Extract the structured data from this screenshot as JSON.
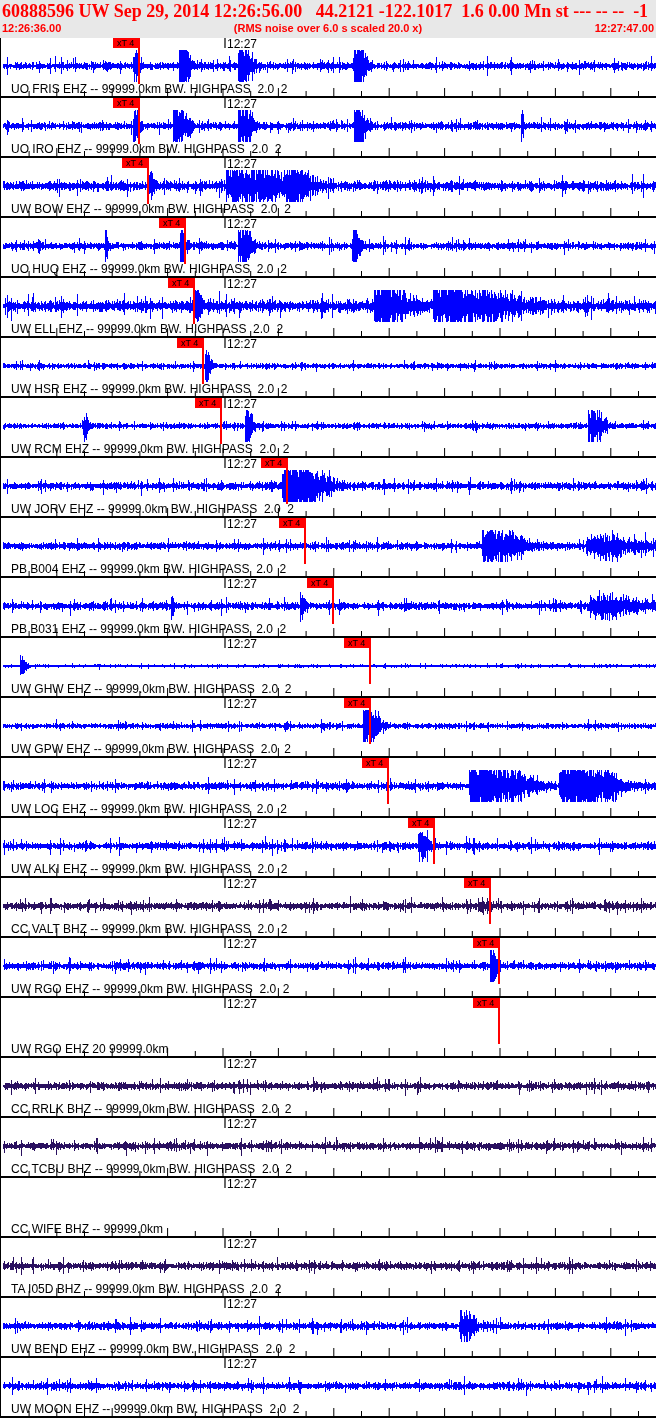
{
  "header": {
    "title": "60888596 UW Sep 29, 2014 12:26:56.00   44.2121 -122.1017  1.6 0.00 Mn st --- -- --  -1",
    "start_time": "12:26:36.00",
    "note": "(RMS noise over 6.0 s scaled 20.0 x)",
    "end_time": "12:27:47.00"
  },
  "traces": [
    {
      "kind": "waveform",
      "label": "UO FRIS EHZ -- 99999.0km BW. HIGHPASS  2.0  2",
      "time_label": "12:27",
      "color": "#0000ff",
      "pick": "xT 4"
    },
    {
      "kind": "waveform",
      "label": "UO IRO EHZ -- 99999.0km BW. HIGHPASS  2.0  2",
      "time_label": "12:27",
      "color": "#0000ff",
      "pick": "xT 4"
    },
    {
      "kind": "waveform",
      "label": "UW BOW EHZ -- 99999.0km BW. HIGHPASS  2.0  2",
      "time_label": "12:27",
      "color": "#0000ff",
      "pick": "xT 4"
    },
    {
      "kind": "waveform",
      "label": "UO HUQ EHZ -- 99999.0km BW. HIGHPASS  2.0  2",
      "time_label": "12:27",
      "color": "#0000ff",
      "pick": "xT 4"
    },
    {
      "kind": "waveform",
      "label": "UW ELL EHZ -- 99999.0km BW. HIGHPASS  2.0  2",
      "time_label": "12:27",
      "color": "#0000ff",
      "pick": "xT 4"
    },
    {
      "kind": "waveform",
      "label": "UW HSR EHZ -- 99999.0km BW. HIGHPASS  2.0  2",
      "time_label": "12:27",
      "color": "#0000ff",
      "pick": "xT 4"
    },
    {
      "kind": "waveform",
      "label": "UW RCM EHZ -- 99999.0km BW. HIGHPASS  2.0  2",
      "time_label": "12:27",
      "color": "#0000ff",
      "pick": "xT 4"
    },
    {
      "kind": "waveform",
      "label": "UW JORV EHZ -- 99999.0km BW. HIGHPASS  2.0  2",
      "time_label": "12:27",
      "color": "#0000ff",
      "pick": "xT 4"
    },
    {
      "kind": "waveform",
      "label": "PB B004 EHZ -- 99999.0km BW. HIGHPASS  2.0  2",
      "time_label": "12:27",
      "color": "#0000ff",
      "pick": "xT 4"
    },
    {
      "kind": "waveform",
      "label": "PB B031 EHZ -- 99999.0km BW. HIGHPASS  2.0  2",
      "time_label": "12:27",
      "color": "#0000ff",
      "pick": "xT 4"
    },
    {
      "kind": "waveform",
      "label": "UW GHW EHZ -- 99999.0km BW. HIGHPASS  2.0  2",
      "time_label": "12:27",
      "color": "#0000ff",
      "pick": "xT 4"
    },
    {
      "kind": "waveform",
      "label": "UW GPW EHZ -- 99999.0km BW. HIGHPASS  2.0  2",
      "time_label": "12:27",
      "color": "#0000ff",
      "pick": "xT 4"
    },
    {
      "kind": "waveform",
      "label": "UW LOC EHZ -- 99999.0km BW. HIGHPASS  2.0  2",
      "time_label": "12:27",
      "color": "#0000ff",
      "pick": "xT 4"
    },
    {
      "kind": "waveform",
      "label": "UW ALKI EHZ -- 99999.0km BW. HIGHPASS  2.0  2",
      "time_label": "12:27",
      "color": "#0000ff",
      "pick": "xT 4"
    },
    {
      "kind": "waveform",
      "label": "CC VALT BHZ -- 99999.0km BW. HIGHPASS  2.0  2",
      "time_label": "12:27",
      "color": "#2a1060",
      "pick": "xT 4"
    },
    {
      "kind": "waveform",
      "label": "UW RGO EHZ -- 99999.0km BW. HIGHPASS  2.0  2",
      "time_label": "12:27",
      "color": "#0000ff",
      "pick": "xT 4"
    },
    {
      "kind": "empty",
      "label": "UW RGO EHZ 20 99999.0km",
      "time_label": "12:27",
      "pick": "xT 4"
    },
    {
      "kind": "waveform",
      "label": "CC RRLK BHZ -- 99999.0km BW. HIGHPASS  2.0  2",
      "time_label": "12:27",
      "color": "#2a1060"
    },
    {
      "kind": "waveform",
      "label": "CC TCBU BHZ -- 99999.0km BW. HIGHPASS  2.0  2",
      "time_label": "12:27",
      "color": "#2a1060"
    },
    {
      "kind": "empty",
      "label": "CC WIFE BHZ -- 99999.0km",
      "time_label": "12:27"
    },
    {
      "kind": "waveform",
      "label": "TA I05D BHZ -- 99999.0km BW. HIGHPASS  2.0  2",
      "time_label": "12:27",
      "color": "#2a1060"
    },
    {
      "kind": "waveform",
      "label": "UW BEND EHZ -- 99999.0km BW. HIGHPASS  2.0  2",
      "time_label": "12:27",
      "color": "#0000ff"
    },
    {
      "kind": "waveform",
      "label": "UW MOON EHZ -- 99999.0km BW. HIGHPASS  2.0  2",
      "time_label": "12:27",
      "color": "#0000ff"
    }
  ]
}
